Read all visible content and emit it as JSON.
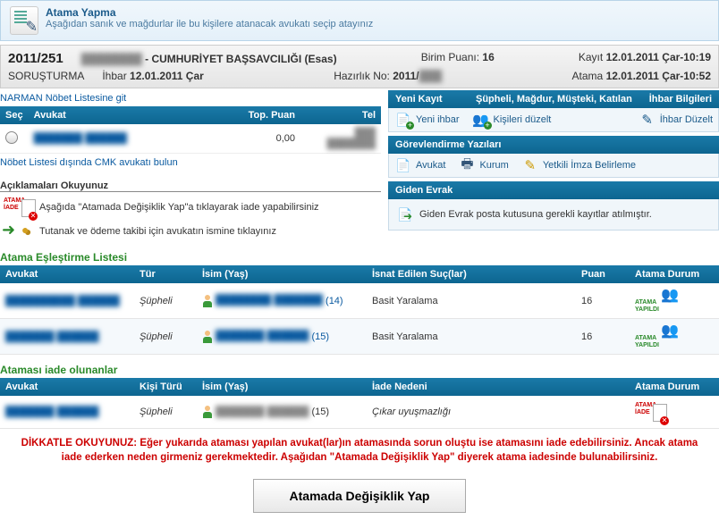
{
  "header": {
    "title": "Atama Yapma",
    "subtitle": "Aşağıdan sanık ve mağdurlar ile bu kişilere atanacak avukatı seçip atayınız"
  },
  "info": {
    "case_no": "2011/251",
    "court_blur": "████████",
    "court": "- CUMHURİYET BAŞSAVCILIĞI (Esas)",
    "birim_puan_label": "Birim Puanı:",
    "birim_puan": "16",
    "kayit_label": "Kayıt",
    "kayit": "12.01.2011 Çar-10:19",
    "line2_left": "SORUŞTURMA",
    "ihbar_label": "İhbar",
    "ihbar": "12.01.2011 Çar",
    "hazirlik_label": "Hazırlık No:",
    "hazirlik": "2011/",
    "hazirlik_blur": "███",
    "atama_label": "Atama",
    "atama": "12.01.2011 Çar-10:52"
  },
  "left": {
    "nobet_link": "NARMAN Nöbet Listesine git",
    "table_headers": {
      "sec": "Seç",
      "avukat": "Avukat",
      "puan": "Top. Puan",
      "tel": "Tel"
    },
    "row": {
      "avukat_blur": "███████ ██████",
      "puan": "0,00",
      "tel_blur": "███ ███████"
    },
    "bulun_link": "Nöbet Listesi dışında CMK avukatı bulun",
    "notes_title": "Açıklamaları Okuyunuz",
    "note1": "Aşağıda \"Atamada Değişiklik Yap\"a tıklayarak iade yapabilirsiniz",
    "note2": "Tutanak ve ödeme takibi için avukatın ismine tıklayınız"
  },
  "right": {
    "yeni_kayit": "Yeni Kayıt",
    "supheli_header": "Şüpheli, Mağdur, Müşteki, Katılan",
    "ihbar_bilgileri": "İhbar Bilgileri",
    "yeni_ihbar": "Yeni ihbar",
    "kisileri_duzelt": "Kişileri düzelt",
    "ihbar_duzelt": "İhbar Düzelt",
    "gorevlendirme": "Görevlendirme Yazıları",
    "avukat": "Avukat",
    "kurum": "Kurum",
    "yetkili": "Yetkili İmza Belirleme",
    "giden_evrak": "Giden Evrak",
    "giden_evrak_text": "Giden Evrak posta kutusuna gerekli kayıtlar atılmıştır."
  },
  "eslestirme": {
    "title": "Atama Eşleştirme Listesi",
    "headers": {
      "avukat": "Avukat",
      "tur": "Tür",
      "isim": "İsim (Yaş)",
      "suc": "İsnat Edilen Suç(lar)",
      "puan": "Puan",
      "durum": "Atama Durum"
    },
    "rows": [
      {
        "avukat_blur": "██████████ ██████",
        "tur": "Şüpheli",
        "isim_blur": "████████ ███████",
        "yas": "(14)",
        "suc": "Basit Yaralama",
        "puan": "16"
      },
      {
        "avukat_blur": "███████ ██████",
        "tur": "Şüpheli",
        "isim_blur": "███████ ██████",
        "yas": "(15)",
        "suc": "Basit Yaralama",
        "puan": "16"
      }
    ]
  },
  "iade": {
    "title": "Ataması iade olunanlar",
    "headers": {
      "avukat": "Avukat",
      "tur": "Kişi Türü",
      "isim": "İsim (Yaş)",
      "neden": "İade Nedeni",
      "durum": "Atama Durum"
    },
    "rows": [
      {
        "avukat_blur": "███████ ██████",
        "tur": "Şüpheli",
        "isim_blur": "███████ ██████",
        "yas": "(15)",
        "neden": "Çıkar uyuşmazlığı"
      }
    ]
  },
  "warning": "DİKKATLE OKUYUNUZ: Eğer yukarıda ataması yapılan avukat(lar)ın atamasında sorun oluştu ise atamasını iade edebilirsiniz. Ancak atama iade ederken neden girmeniz gerekmektedir. Aşağıdan \"Atamada Değişiklik Yap\" diyerek atama iadesinde bulunabilirsiniz.",
  "button": "Atamada Değişiklik Yap"
}
